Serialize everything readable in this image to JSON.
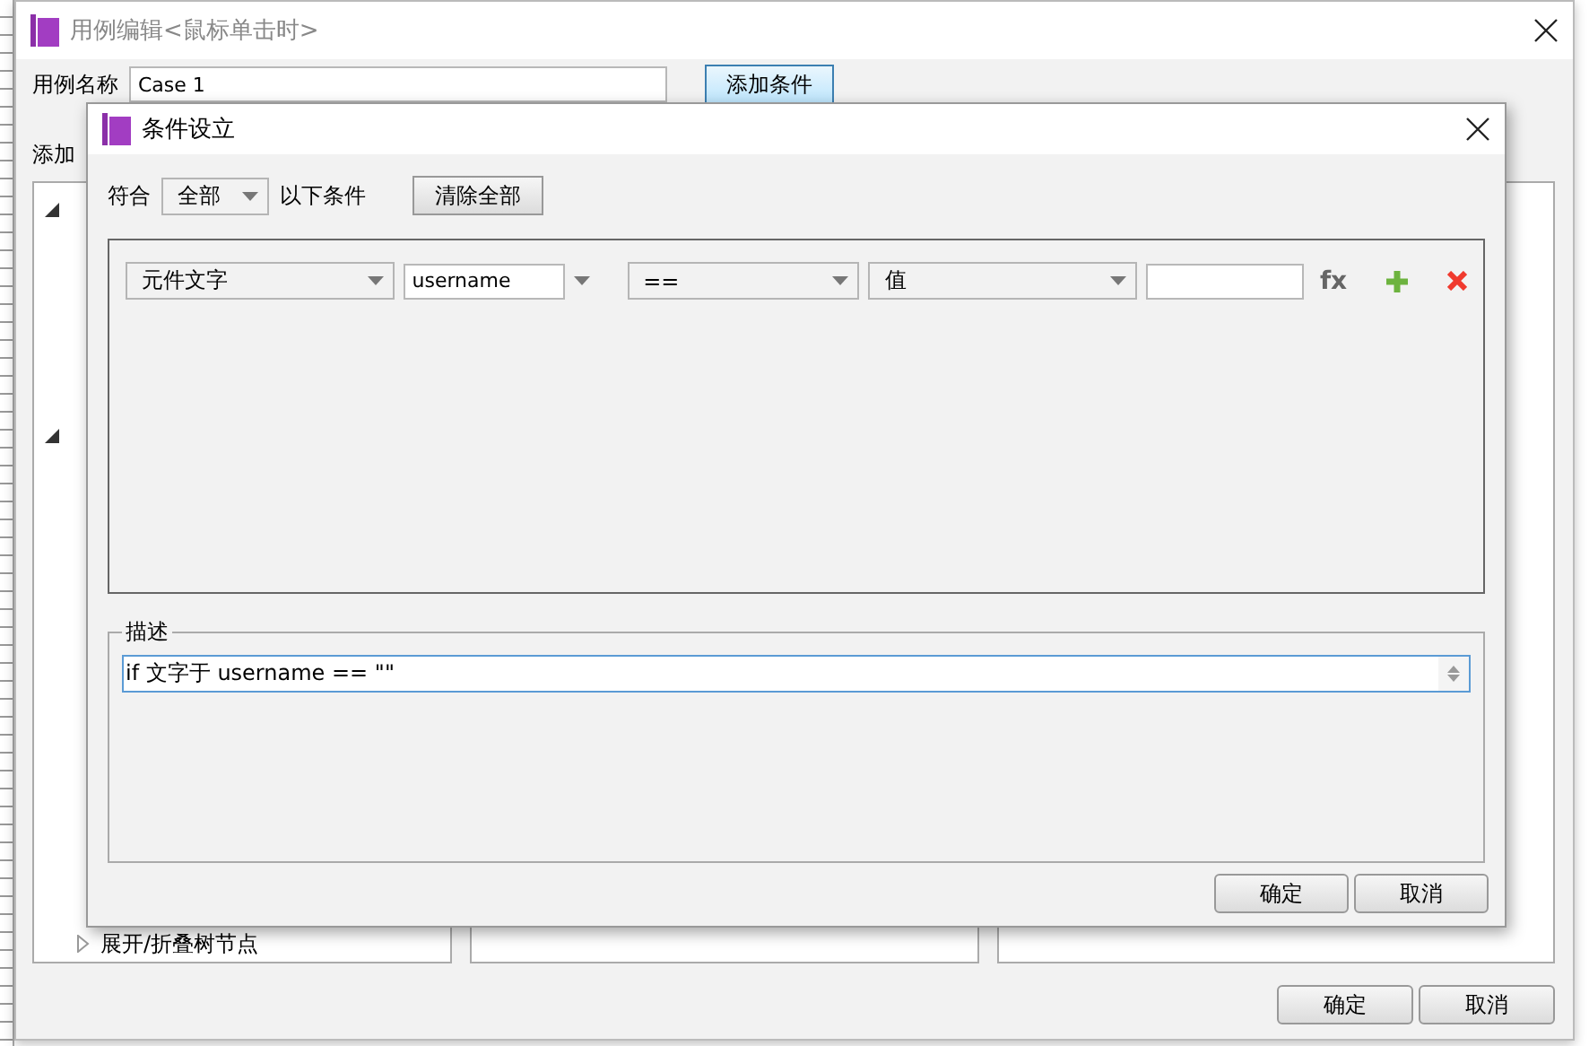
{
  "background_window": {
    "title": "用例编辑<鼠标单击时>",
    "case_name_label": "用例名称",
    "case_name": "Case 1",
    "add_condition_button": "添加条件",
    "actions_label": "添加",
    "tree_bottom_item": "展开/折叠树节点",
    "buttons": [
      "确定",
      "取消"
    ]
  },
  "dialog": {
    "title": "条件设立",
    "match_label": "符合",
    "match_mode": "全部",
    "match_suffix": "以下条件",
    "clear_button": "清除全部",
    "conditions": [
      {
        "target_type": "元件文字",
        "target": "username",
        "operator": "==",
        "value_type": "值",
        "fx": "fx"
      }
    ],
    "description_label": "描述",
    "description": "if 文字于 username == \"\"",
    "buttons": [
      "确定",
      "取消"
    ]
  }
}
